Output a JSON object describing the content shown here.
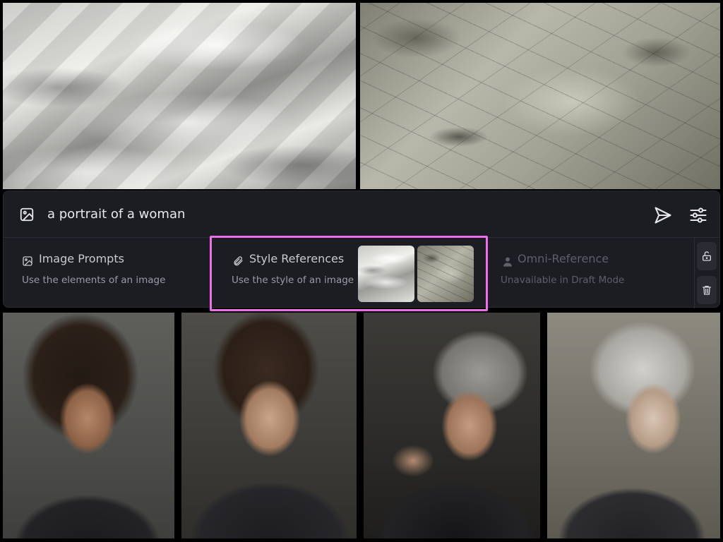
{
  "prompt": {
    "text": "a portrait of a woman",
    "icon": "image-icon",
    "send_icon": "send-icon",
    "settings_icon": "sliders-icon"
  },
  "sections": {
    "image_prompts": {
      "title": "Image Prompts",
      "description": "Use the elements of an image",
      "icon": "image-icon"
    },
    "style_references": {
      "title": "Style References",
      "description": "Use the style of an image",
      "icon": "paperclip-icon",
      "thumbnails": [
        "silk-fabric",
        "grunge-texture"
      ]
    },
    "omni_reference": {
      "title": "Omni-Reference",
      "description": "Unavailable in Draft Mode",
      "icon": "person-icon",
      "disabled": true
    }
  },
  "side_actions": [
    "unlock-icon",
    "trash-icon"
  ],
  "reference_images": [
    "silk-fabric",
    "grunge-texture"
  ],
  "results": [
    "portrait-curly-hair",
    "portrait-brunette",
    "portrait-elderly-gray-hair",
    "portrait-elderly-white-hair"
  ],
  "colors": {
    "panel_bg": "#1c1d23",
    "highlight": "#ee6ee9",
    "text_primary": "#e9e9ec",
    "text_muted": "#9a9ba3",
    "text_disabled": "#5e5f67"
  }
}
